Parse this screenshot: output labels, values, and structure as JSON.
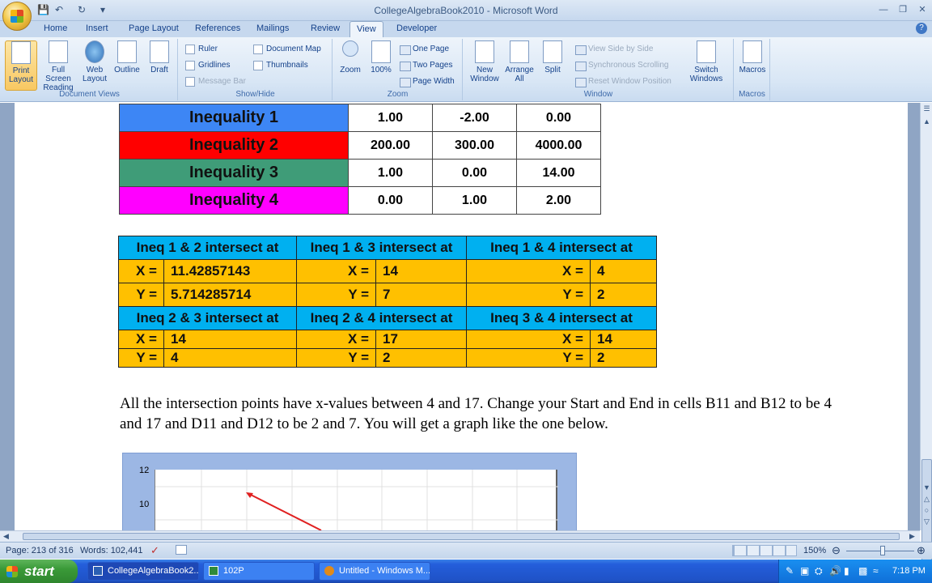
{
  "window": {
    "title": "CollegeAlgebraBook2010 - Microsoft Word"
  },
  "tabs": [
    "Home",
    "Insert",
    "Page Layout",
    "References",
    "Mailings",
    "Review",
    "View",
    "Developer"
  ],
  "active_tab": "View",
  "ribbon": {
    "document_views": {
      "label": "Document Views",
      "print_layout": "Print Layout",
      "full_screen": "Full Screen Reading",
      "web_layout": "Web Layout",
      "outline": "Outline",
      "draft": "Draft"
    },
    "show_hide": {
      "label": "Show/Hide",
      "ruler": "Ruler",
      "gridlines": "Gridlines",
      "message_bar": "Message Bar",
      "document_map": "Document Map",
      "thumbnails": "Thumbnails"
    },
    "zoom": {
      "label": "Zoom",
      "zoom": "Zoom",
      "hundred": "100%",
      "one_page": "One Page",
      "two_pages": "Two Pages",
      "page_width": "Page Width"
    },
    "window": {
      "label": "Window",
      "new_window": "New Window",
      "arrange_all": "Arrange All",
      "split": "Split",
      "side_by_side": "View Side by Side",
      "sync_scroll": "Synchronous Scrolling",
      "reset_pos": "Reset Window Position",
      "switch_windows": "Switch Windows"
    },
    "macros": {
      "label": "Macros",
      "macros": "Macros"
    }
  },
  "inequalities": [
    {
      "name": "Inequality 1",
      "color": "#3d86f5",
      "values": [
        "1.00",
        "-2.00",
        "0.00"
      ]
    },
    {
      "name": "Inequality 2",
      "color": "#ff0000",
      "values": [
        "200.00",
        "300.00",
        "4000.00"
      ]
    },
    {
      "name": "Inequality 3",
      "color": "#3f9c78",
      "values": [
        "1.00",
        "0.00",
        "14.00"
      ]
    },
    {
      "name": "Inequality 4",
      "color": "#ff00ff",
      "values": [
        "0.00",
        "1.00",
        "2.00"
      ]
    }
  ],
  "intersections": {
    "h1": "Ineq 1 & 2 intersect at",
    "h2": "Ineq 1 & 3 intersect at",
    "h3": "Ineq 1 & 4 intersect at",
    "h4": "Ineq 2 & 3 intersect at",
    "h5": "Ineq 2 & 4 intersect at",
    "h6": "Ineq 3 & 4 intersect at",
    "xlabel": "X =",
    "ylabel": "Y =",
    "p12": {
      "x": "11.42857143",
      "y": "5.714285714"
    },
    "p13": {
      "x": "14",
      "y": "7"
    },
    "p14": {
      "x": "4",
      "y": "2"
    },
    "p23": {
      "x": "14",
      "y": "4"
    },
    "p24": {
      "x": "17",
      "y": "2"
    },
    "p34": {
      "x": "14",
      "y": "2"
    }
  },
  "paragraph": "All the intersection points have x-values between 4 and 17. Change your Start and End in cells B11 and B12 to be 4 and 17 and D11 and D12 to be 2 and 7. You will get a graph like the one below.",
  "chart": {
    "y_ticks": [
      "12",
      "10"
    ]
  },
  "status": {
    "page": "Page: 213 of 316",
    "words": "Words: 102,441",
    "zoom": "150%"
  },
  "taskbar": {
    "start": "start",
    "items": [
      "CollegeAlgebraBook2...",
      "102P",
      "Untitled - Windows M..."
    ],
    "clock": "7:18 PM"
  }
}
